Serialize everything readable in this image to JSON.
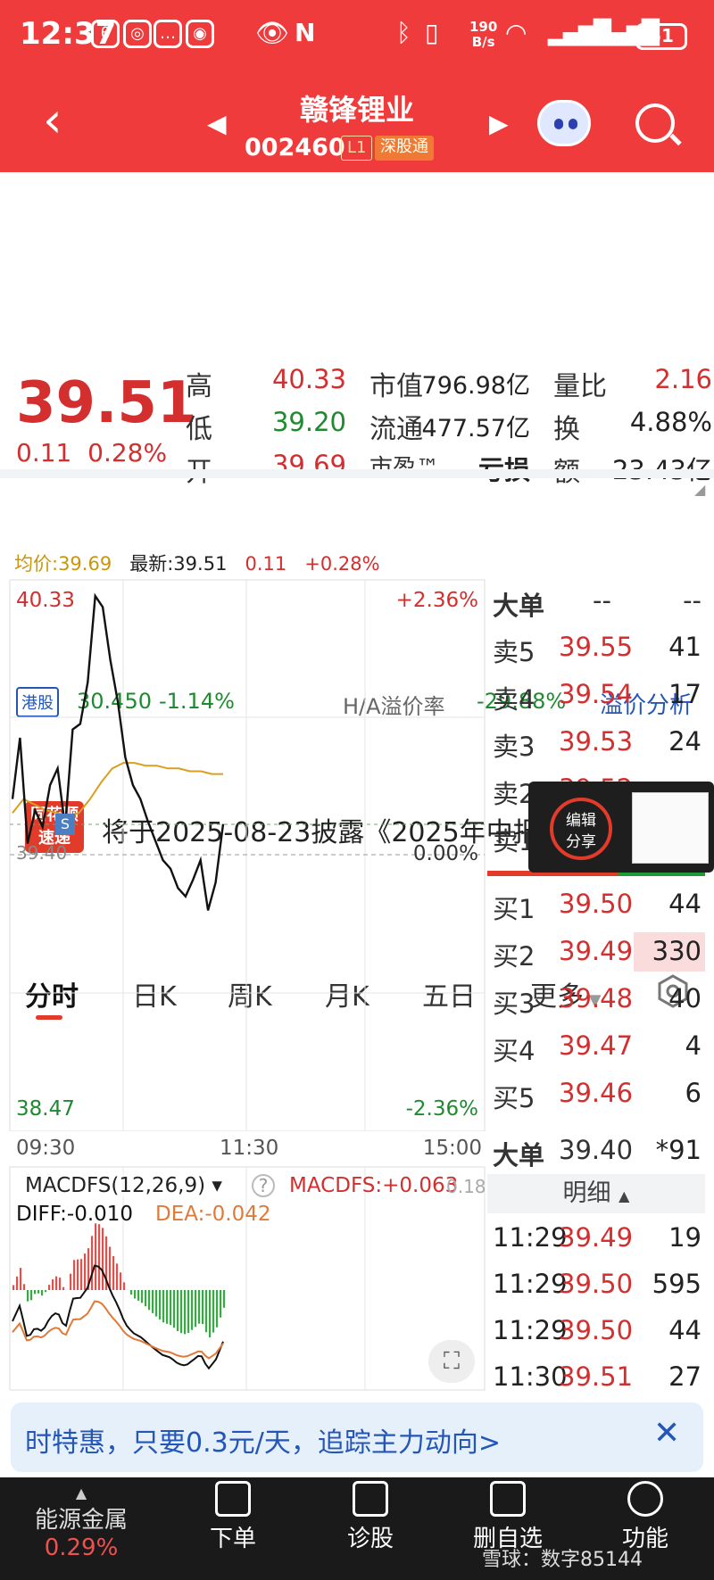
{
  "status": {
    "time": "12:37",
    "net_speed_top": "190",
    "net_speed_unit": "B/s",
    "battery": "51"
  },
  "header": {
    "stock_name": "赣锋锂业",
    "stock_code": "002460",
    "tag_level": "L1",
    "tag_connect": "深股通"
  },
  "quote": {
    "price": "39.51",
    "change": "0.11",
    "change_pct": "0.28%",
    "labels": {
      "high": "高",
      "low": "低",
      "open": "开",
      "mcap": "市值",
      "float": "流通",
      "pe": "市盈™",
      "vr": "量比",
      "turnover": "换",
      "amount": "额"
    },
    "values": {
      "high": "40.33",
      "low": "39.20",
      "open": "39.69",
      "mcap": "796.98亿",
      "float": "477.57亿",
      "pe": "亏损",
      "vr": "2.16",
      "turnover": "4.88%",
      "amount": "23.43亿"
    }
  },
  "hk": {
    "badge": "港股",
    "price": "30.450",
    "change": "-1.14%",
    "premium_label": "H/A溢价率",
    "premium": "-29.88%",
    "link": "溢价分析"
  },
  "notice": {
    "logo_top": "同花顺",
    "logo_bottom": "速递",
    "text": "将于2025-08-23披露《2025年中报》"
  },
  "tabs": [
    "分时",
    "日K",
    "周K",
    "月K",
    "五日",
    "更多"
  ],
  "info": {
    "avg_label": "均价:39.69",
    "latest_label": "最新:39.51",
    "change": "0.11",
    "change_pct": "+0.28%"
  },
  "chart": {
    "y_high": "40.33",
    "y_low": "38.47",
    "pct_high": "+2.36%",
    "pct_low": "-2.36%",
    "pct_mid": "0.00%",
    "prev_close_label": "39.40",
    "x_ticks": [
      "09:30",
      "11:30",
      "15:00"
    ],
    "macd_title": "MACDFS(12,26,9)",
    "macd_value": "MACDFS:+0.063",
    "diff": "DIFF:-0.010",
    "dea": "DEA:-0.042",
    "macd_axis": "0.18"
  },
  "chart_data": {
    "type": "line",
    "series": [
      {
        "values": [
          39.6,
          39.82,
          39.44,
          39.56,
          39.5,
          39.65,
          39.71,
          39.5,
          39.85,
          39.87,
          40.02,
          40.33,
          40.29,
          40.1,
          39.95,
          39.75,
          39.65,
          39.6,
          39.52,
          39.45,
          39.38,
          39.35,
          39.28,
          39.25,
          39.31,
          39.38,
          39.2,
          39.3,
          39.51
        ]
      },
      {
        "values": [
          39.55,
          39.6,
          39.58,
          39.56,
          39.55,
          39.54,
          39.55,
          39.6,
          39.66,
          39.71,
          39.73,
          39.73,
          39.72,
          39.72,
          39.71,
          39.71,
          39.7,
          39.7,
          39.69,
          39.69
        ]
      }
    ],
    "ylim": [
      38.47,
      40.33
    ]
  },
  "book": {
    "big_label": "大单",
    "big_dash1": "--",
    "big_dash2": "--",
    "asks": [
      {
        "label": "卖5",
        "price": "39.55",
        "vol": "41"
      },
      {
        "label": "卖4",
        "price": "39.54",
        "vol": "17"
      },
      {
        "label": "卖3",
        "price": "39.53",
        "vol": "24"
      },
      {
        "label": "卖2",
        "price": "39.52",
        "vol": ""
      },
      {
        "label": "卖1",
        "price": "",
        "vol": ""
      }
    ],
    "bids": [
      {
        "label": "买1",
        "price": "39.50",
        "vol": "44"
      },
      {
        "label": "买2",
        "price": "39.49",
        "vol": "330"
      },
      {
        "label": "买3",
        "price": "39.48",
        "vol": "40"
      },
      {
        "label": "买4",
        "price": "39.47",
        "vol": "4"
      },
      {
        "label": "买5",
        "price": "39.46",
        "vol": "6"
      }
    ],
    "big_price": "39.40",
    "big_vol": "*91"
  },
  "edit_share": {
    "line1": "编辑",
    "line2": "分享"
  },
  "detail": {
    "title": "明细",
    "rows": [
      {
        "t": "11:29",
        "p": "39.49",
        "v": "19"
      },
      {
        "t": "11:29",
        "p": "39.50",
        "v": "595"
      },
      {
        "t": "11:29",
        "p": "39.50",
        "v": "44"
      },
      {
        "t": "11:30",
        "p": "39.51",
        "v": "27"
      }
    ]
  },
  "promo": {
    "text": "时特惠，只要0.3元/天，追踪主力动向>"
  },
  "bottom": {
    "sector": "能源金属",
    "sector_pct": "0.29%",
    "items": [
      "下单",
      "诊股",
      "删自选",
      "功能"
    ],
    "watermark": "雪球：数字85144"
  }
}
